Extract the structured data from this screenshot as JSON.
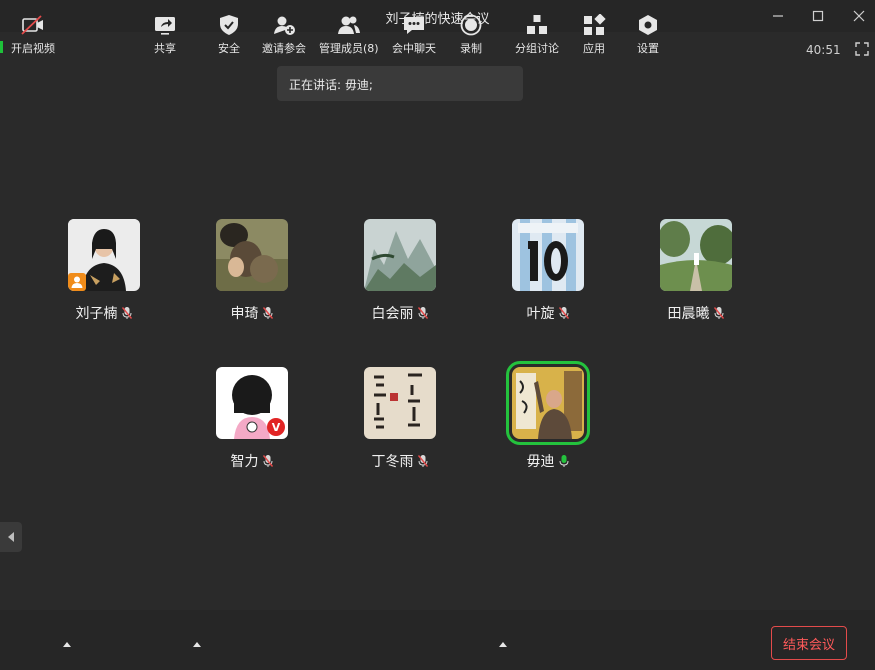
{
  "window": {
    "title": "刘子楠的快速会议",
    "timer": "40:51"
  },
  "speaking": {
    "text": "正在讲话: 毋迪;"
  },
  "participants": [
    {
      "name": "刘子楠",
      "mic": "muted",
      "badge": "host"
    },
    {
      "name": "申琦",
      "mic": "muted"
    },
    {
      "name": "白会丽",
      "mic": "muted"
    },
    {
      "name": "叶旋",
      "mic": "muted"
    },
    {
      "name": "田晨曦",
      "mic": "muted"
    },
    {
      "name": "智力",
      "mic": "muted",
      "badge": "V"
    },
    {
      "name": "丁冬雨",
      "mic": "muted"
    },
    {
      "name": "毋迪",
      "mic": "active",
      "speaking": true
    }
  ],
  "toolbar": {
    "video": "开启视频",
    "share": "共享",
    "security": "安全",
    "invite": "邀请参会",
    "members": "管理成员(8)",
    "chat": "会中聊天",
    "record": "录制",
    "breakout": "分组讨论",
    "apps": "应用",
    "settings": "设置",
    "end": "结束会议"
  },
  "colors": {
    "background": "#2a2a2a",
    "active_speaker": "#24c23d",
    "end_button": "#e34b4b",
    "host_badge": "#f08c1a"
  }
}
